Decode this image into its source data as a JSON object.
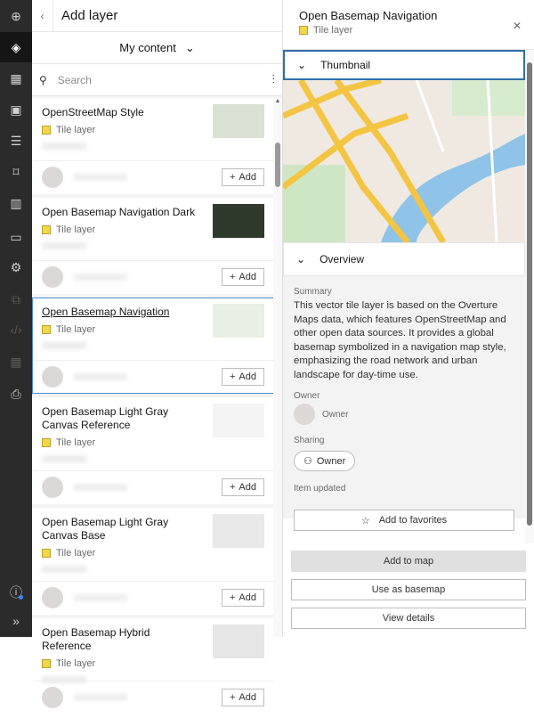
{
  "rail": [
    "add-icon",
    "layers-icon",
    "table-icon",
    "basemap-icon",
    "legend-icon",
    "bookmark-icon",
    "charts-icon",
    "folder-icon",
    "settings-icon",
    "share-icon",
    "embed-icon",
    "apps-icon",
    "print-icon"
  ],
  "left": {
    "title": "Add layer",
    "source": "My content",
    "search_placeholder": "Search",
    "items": [
      {
        "name": "OpenStreetMap Style",
        "type": "Tile layer",
        "add": "Add",
        "thumb": "osm"
      },
      {
        "name": "Open Basemap Navigation Dark",
        "type": "Tile layer",
        "add": "Add",
        "thumb": "dark"
      },
      {
        "name": "Open Basemap Navigation",
        "type": "Tile layer",
        "add": "Add",
        "thumb": "nav"
      },
      {
        "name": "Open Basemap Light Gray Canvas Reference",
        "type": "Tile layer",
        "add": "Add",
        "thumb": "ref"
      },
      {
        "name": "Open Basemap Light Gray Canvas Base",
        "type": "Tile layer",
        "add": "Add",
        "thumb": "gray"
      },
      {
        "name": "Open Basemap Hybrid Reference",
        "type": "Tile layer",
        "add": "Add",
        "thumb": "hyb"
      }
    ]
  },
  "right": {
    "title": "Open Basemap Navigation",
    "type": "Tile layer",
    "thumbnail": "Thumbnail",
    "overview": "Overview",
    "summary_label": "Summary",
    "summary": "This vector tile layer is based on the Overture Maps data, which features OpenStreetMap and other open data sources. It provides a global basemap symbolized in a navigation map style, emphasizing the road network and urban landscape for day-time use.",
    "owner_label": "Owner",
    "owner": "Owner",
    "sharing_label": "Sharing",
    "sharing": "Owner",
    "updated_label": "Item updated",
    "favorites": "Add to favorites",
    "add_to_map": "Add to map",
    "use_basemap": "Use as basemap",
    "view_details": "View details"
  }
}
